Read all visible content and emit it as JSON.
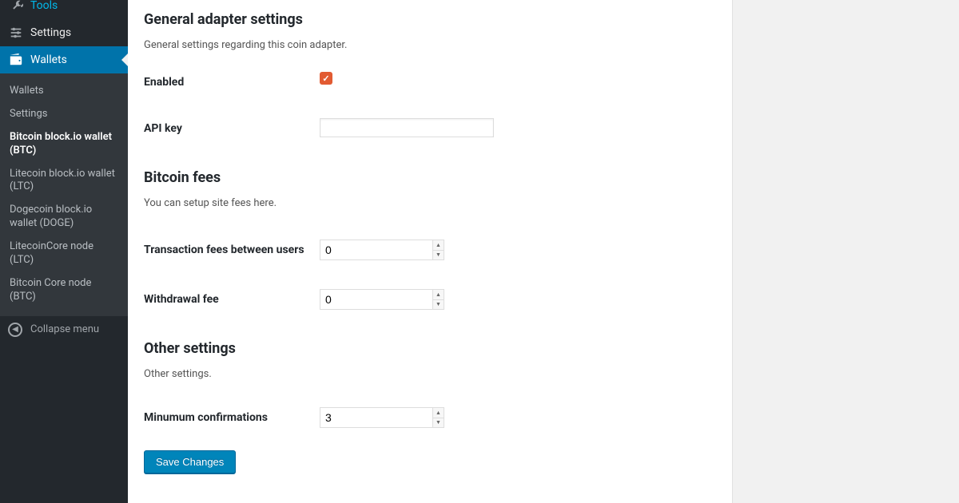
{
  "sidebar": {
    "tools": "Tools",
    "settings": "Settings",
    "wallets": "Wallets",
    "submenu": [
      "Wallets",
      "Settings",
      "Bitcoin block.io wallet (BTC)",
      "Litecoin block.io wallet (LTC)",
      "Dogecoin block.io wallet (DOGE)",
      "LitecoinCore node (LTC)",
      "Bitcoin Core node (BTC)"
    ],
    "collapse": "Collapse menu"
  },
  "sections": {
    "general": {
      "title": "General adapter settings",
      "desc": "General settings regarding this coin adapter.",
      "enabled_label": "Enabled",
      "apikey_label": "API key",
      "apikey_value": ""
    },
    "fees": {
      "title": "Bitcoin fees",
      "desc": "You can setup site fees here.",
      "tx_label": "Transaction fees between users",
      "tx_value": "0",
      "wd_label": "Withdrawal fee",
      "wd_value": "0"
    },
    "other": {
      "title": "Other settings",
      "desc": "Other settings.",
      "minconf_label": "Minumum confirmations",
      "minconf_value": "3"
    }
  },
  "save_label": "Save Changes"
}
